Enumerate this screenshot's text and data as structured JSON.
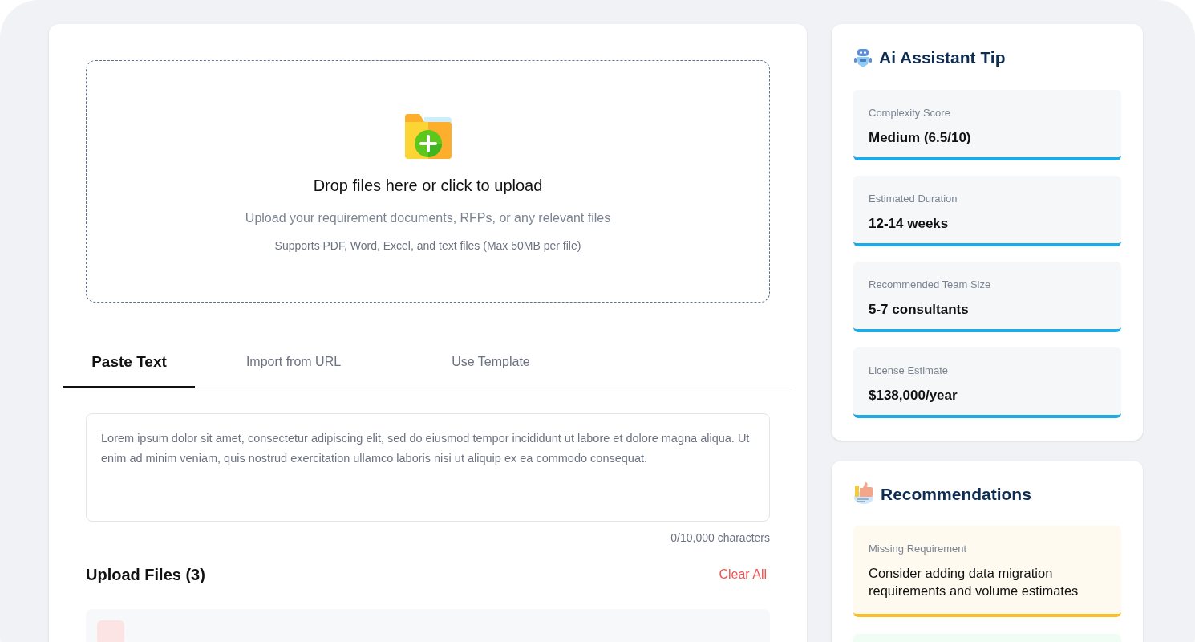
{
  "upload": {
    "title": "Drop files here or click to upload",
    "subtitle": "Upload your requirement documents, RFPs, or any relevant files",
    "hint": "Supports PDF, Word, Excel, and text files (Max 50MB per file)"
  },
  "tabs": [
    {
      "label": "Paste Text",
      "selected": true
    },
    {
      "label": "Import from URL",
      "selected": false
    },
    {
      "label": "Use Template",
      "selected": false
    }
  ],
  "text_input": {
    "value": "Lorem ipsum dolor sit amet, consectetur adipiscing elit, sed do eiusmod tempor incididunt ut labore et dolore magna aliqua. Ut enim ad minim veniam, quis nostrud exercitation ullamco laboris nisi ut aliquip ex ea commodo consequat.",
    "counter": "0/10,000 characters"
  },
  "files": {
    "title": "Upload Files (3)",
    "clear": "Clear All",
    "rows": [
      {
        "color": "#fde4e4"
      }
    ]
  },
  "ai_tip": {
    "title": "Ai Assistant Tip",
    "metrics": [
      {
        "label": "Complexity Score",
        "value": "Medium (6.5/10)",
        "color": "#1eaae7"
      },
      {
        "label": "Estimated Duration",
        "value": "12-14 weeks",
        "color": "#1eaae7"
      },
      {
        "label": "Recommended Team Size",
        "value": "5-7 consultants",
        "color": "#1eaae7"
      },
      {
        "label": "License Estimate",
        "value": "$138,000/year",
        "color": "#1eaae7"
      }
    ]
  },
  "recommendations": {
    "title": "Recommendations",
    "items": [
      {
        "label": "Missing Requirement",
        "text": "Consider adding data migration requirements and volume estimates",
        "color": "#fffaf0"
      },
      {
        "color": "#f0fdf4"
      }
    ]
  }
}
